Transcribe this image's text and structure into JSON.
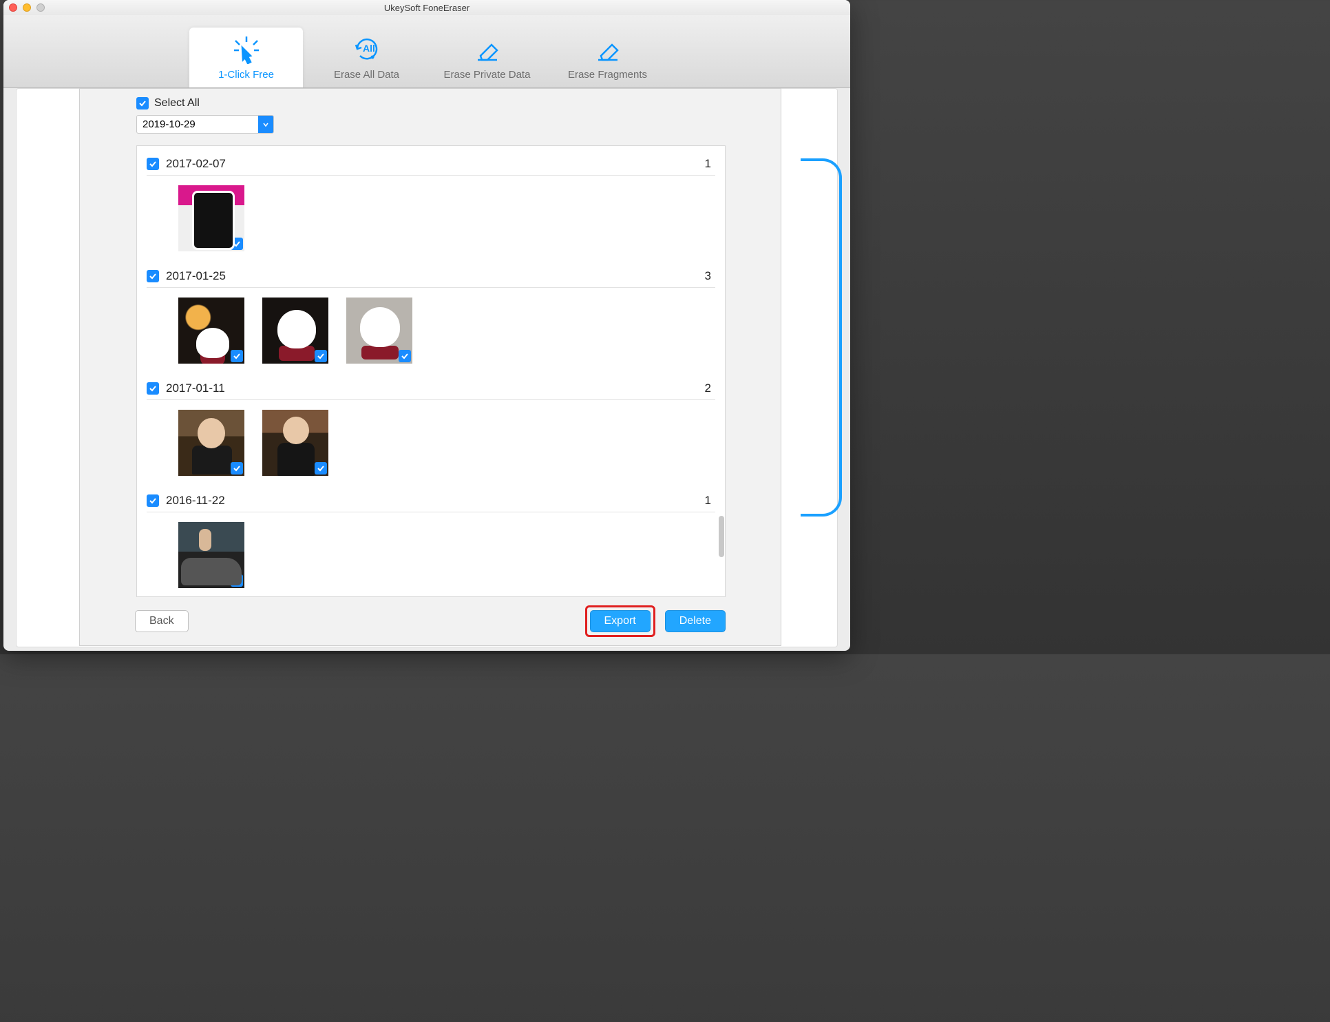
{
  "app_title": "UkeySoft FoneEraser",
  "toolbar": [
    {
      "id": "oneclick",
      "label": "1-Click Free",
      "active": true
    },
    {
      "id": "eraseall",
      "label": "Erase All Data",
      "active": false
    },
    {
      "id": "eraseprivate",
      "label": "Erase Private Data",
      "active": false
    },
    {
      "id": "erasefrag",
      "label": "Erase Fragments",
      "active": false
    }
  ],
  "select_all_label": "Select All",
  "select_all_checked": true,
  "date_dropdown_value": "2019-10-29",
  "groups": [
    {
      "date": "2017-02-07",
      "count": 1,
      "thumbs": [
        "phone"
      ]
    },
    {
      "date": "2017-01-25",
      "count": 3,
      "thumbs": [
        "cat",
        "cat2",
        "cat3"
      ]
    },
    {
      "date": "2017-01-11",
      "count": 2,
      "thumbs": [
        "person",
        "person2"
      ]
    },
    {
      "date": "2016-11-22",
      "count": 1,
      "thumbs": [
        "street"
      ]
    }
  ],
  "buttons": {
    "back": "Back",
    "export": "Export",
    "delete": "Delete"
  }
}
